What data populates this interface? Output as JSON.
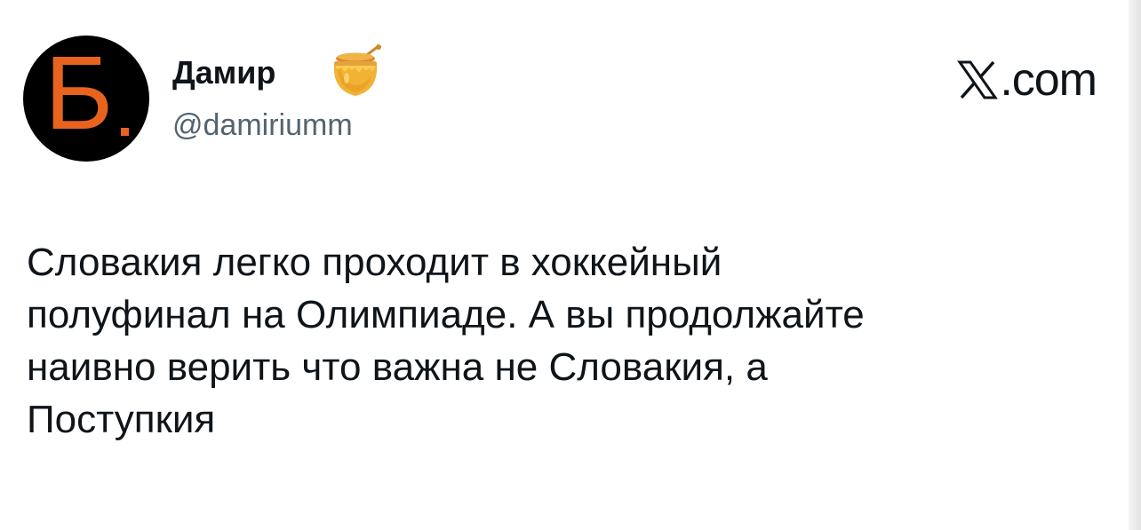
{
  "author": {
    "display_name": "Дамир",
    "handle": "@damiriumm",
    "avatar_letter": "Б",
    "avatar_colors": {
      "background": "#000000",
      "letter": "#e8641e"
    },
    "badge_icon": "honey-pot-icon"
  },
  "brand": {
    "logo_icon": "x-logo-icon",
    "suffix": ".com"
  },
  "tweet": {
    "text": "Словакия легко проходит в хоккейный\nполуфинал на Олимпиаде. А вы продолжайте\nнаивно верить что важна не Словакия, а\nПоступкия"
  },
  "colors": {
    "text_primary": "#0f1419",
    "text_secondary": "#536471"
  }
}
